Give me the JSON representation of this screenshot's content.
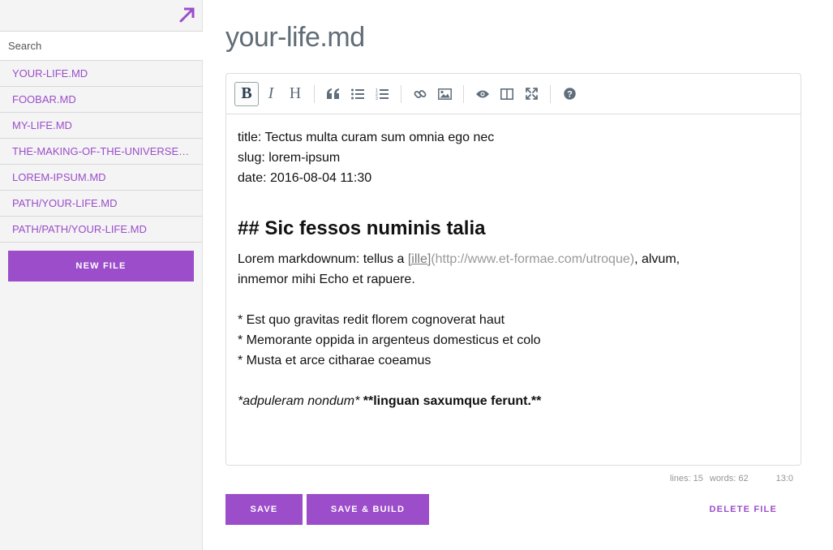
{
  "sidebar": {
    "search_placeholder": "Search",
    "files": [
      "YOUR-LIFE.MD",
      "FOOBAR.MD",
      "MY-LIFE.MD",
      "THE-MAKING-OF-THE-UNIVERSE.MD",
      "LOREM-IPSUM.MD",
      "PATH/YOUR-LIFE.MD",
      "PATH/PATH/YOUR-LIFE.MD"
    ],
    "new_file_label": "NEW FILE"
  },
  "page": {
    "title": "your-life.md"
  },
  "toolbar": {
    "bold": "B",
    "italic": "I",
    "heading": "H",
    "icons": [
      "bold-icon",
      "italic-icon",
      "heading-icon",
      "quote-icon",
      "unordered-list-icon",
      "ordered-list-icon",
      "link-icon",
      "image-icon",
      "preview-icon",
      "side-by-side-icon",
      "fullscreen-icon",
      "help-icon"
    ]
  },
  "editor": {
    "line1": "title: Tectus multa curam sum omnia ego nec",
    "line2": "slug: lorem-ipsum",
    "line3": "date: 2016-08-04 11:30",
    "heading": "## Sic fessos numinis talia",
    "para_prefix": "Lorem markdownum: tellus a ",
    "link_text": "[ille]",
    "link_url": "(http://www.et-formae.com/utroque)",
    "para_suffix": ", alvum,",
    "para_line2": "inmemor mihi Echo et rapuere.",
    "bullet1": "* Est quo gravitas redit florem cognoverat haut",
    "bullet2": "* Memorante oppida in argenteus domesticus et colo",
    "bullet3": "* Musta et arce citharae coeamus",
    "italic_text": "*adpuleram nondum*",
    "bold_text": "**linguan saxumque ferunt.**"
  },
  "status": {
    "lines": "lines: 15",
    "words": "words: 62",
    "cursor": "13:0"
  },
  "actions": {
    "save": "SAVE",
    "save_build": "SAVE & BUILD",
    "delete": "DELETE FILE"
  },
  "colors": {
    "accent": "#9b4dca",
    "title": "#606c76"
  }
}
